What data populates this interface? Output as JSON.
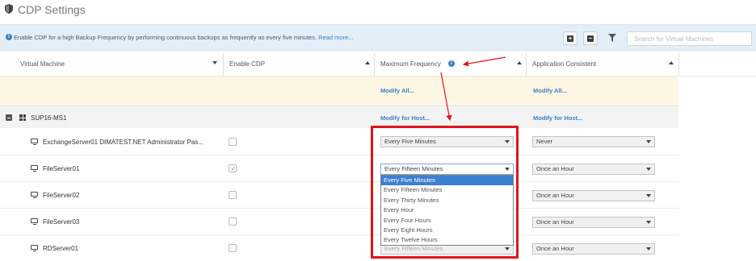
{
  "page": {
    "title": "CDP Settings"
  },
  "info_bar": {
    "text": "Enable CDP for a high Backup Frequency by performing continuous backups as frequently as every five minutes.",
    "read_more": "Read more..."
  },
  "toolbar": {
    "add_glyph": "+",
    "remove_glyph": "−",
    "search_placeholder": "Search for Virtual Machines"
  },
  "columns": [
    "Virtual Machine",
    "Enable CDP",
    "Maximum Frequency",
    "Application Consistent"
  ],
  "modify_all": {
    "frequency": "Modify All...",
    "app_consistent": "Modify All..."
  },
  "group": {
    "name": "SUP16-MS1",
    "modify_frequency": "Modify for Host...",
    "modify_app_consistent": "Modify for Host..."
  },
  "rows": [
    {
      "name": "ExchangeServer01 DIMATEST.NET Administrator Pas...",
      "cdp_enabled": false,
      "frequency": "Every Five Minutes",
      "app_consistent": "Never"
    },
    {
      "name": "FileServer01",
      "cdp_enabled": true,
      "frequency": "Every Fifteen Minutes",
      "app_consistent": "Once an Hour"
    },
    {
      "name": "FileServer02",
      "cdp_enabled": false,
      "frequency": "",
      "app_consistent": "Once an Hour"
    },
    {
      "name": "FileServer03",
      "cdp_enabled": false,
      "frequency": "",
      "app_consistent": "Once an Hour"
    },
    {
      "name": "RDServer01",
      "cdp_enabled": false,
      "frequency": "Every Fifteen Minutes",
      "app_consistent": "Once an Hour"
    }
  ],
  "frequency_options": [
    "Every Five Minutes",
    "Every Fifteen Minutes",
    "Every Thirty Minutes",
    "Every Hour",
    "Every Four Hours",
    "Every Eight Hours",
    "Every Twelve Hours"
  ],
  "selected_option": "Every Five Minutes",
  "colors": {
    "accent": "#3b7fc4",
    "highlight": "#e0141c",
    "selection": "#3d7fd1",
    "modify_row": "#fdf6e3",
    "info_bar": "#e3eef7"
  }
}
